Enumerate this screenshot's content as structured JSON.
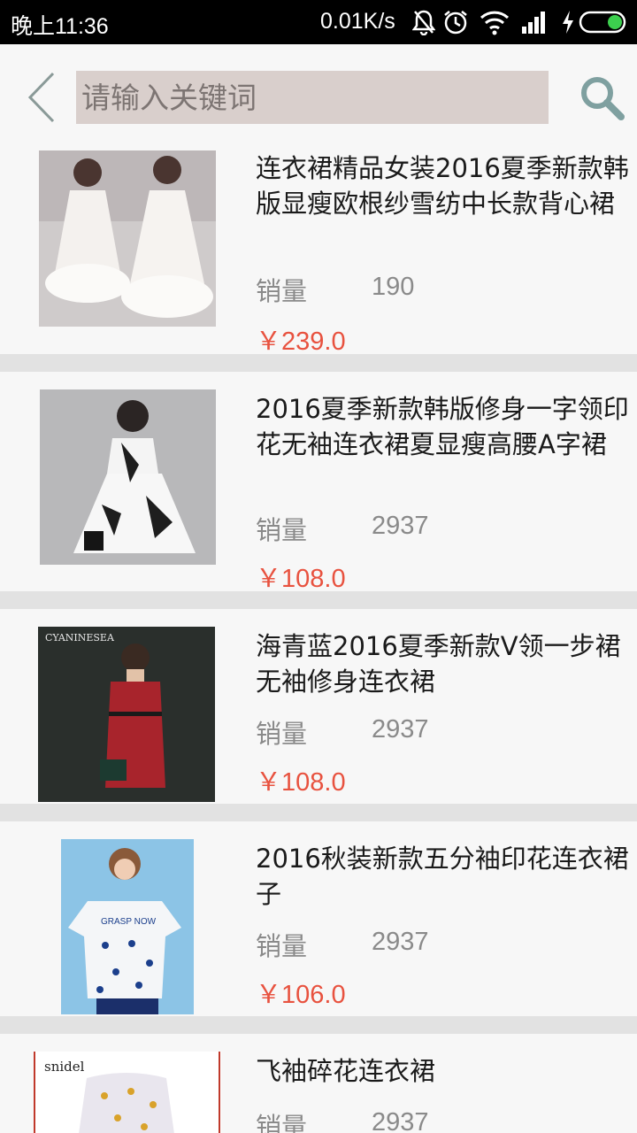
{
  "status_bar": {
    "time": "晚上11:36",
    "speed": "0.01K/s"
  },
  "header": {
    "search_placeholder": "请输入关键词"
  },
  "products": [
    {
      "title": "连衣裙精品女装2016夏季新款韩版显瘦欧根纱雪纺中长款背心裙",
      "sales_label": "销量",
      "sales": "190",
      "price": "￥239.0"
    },
    {
      "title": "2016夏季新款韩版修身一字领印花无袖连衣裙夏显瘦高腰A字裙",
      "sales_label": "销量",
      "sales": "2937",
      "price": "￥108.0"
    },
    {
      "title": "海青蓝2016夏季新款V领一步裙无袖修身连衣裙",
      "sales_label": "销量",
      "sales": "2937",
      "price": "￥108.0"
    },
    {
      "title": "2016秋装新款五分袖印花连衣裙子",
      "sales_label": "销量",
      "sales": "2937",
      "price": "￥106.0"
    },
    {
      "title": "飞袖碎花连衣裙",
      "sales_label": "销量",
      "sales": "2937",
      "price": ""
    }
  ],
  "images": {
    "img3_brand": "CYANINESEA",
    "img4_print": "GRASP NOW",
    "img5_brand": "snidel"
  },
  "colors": {
    "price": "#e8523f",
    "search_bg": "#d9cfcc",
    "divider": "#e2e2e2"
  }
}
